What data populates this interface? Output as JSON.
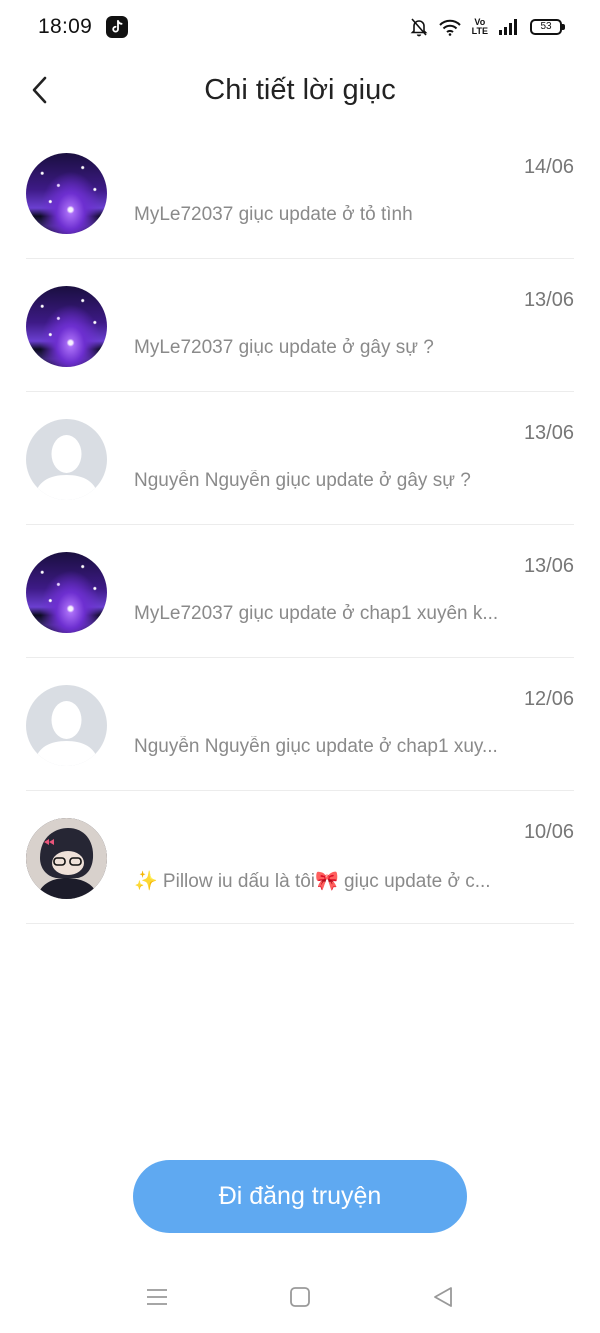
{
  "status_bar": {
    "time": "18:09",
    "battery": "53",
    "volte_top": "Vo",
    "volte_bottom": "LTE",
    "icons": [
      "tiktok-icon",
      "bell-muted-icon",
      "wifi-icon",
      "volte-icon",
      "signal-icon",
      "battery-icon"
    ]
  },
  "header": {
    "title": "Chi tiết lời giục",
    "back_icon": "chevron-left-icon"
  },
  "reminders": [
    {
      "avatar": "galaxy",
      "date": "14/06",
      "text": "MyLe72037 giục update ở tỏ tình"
    },
    {
      "avatar": "galaxy",
      "date": "13/06",
      "text": "MyLe72037 giục update ở gây sự ?"
    },
    {
      "avatar": "default",
      "date": "13/06",
      "text": "Nguyễn Nguyễn giục update ở gây sự ?"
    },
    {
      "avatar": "galaxy",
      "date": "13/06",
      "text": "MyLe72037 giục update ở chap1 xuyên k..."
    },
    {
      "avatar": "default",
      "date": "12/06",
      "text": "Nguyễn Nguyễn giục update ở chap1 xuy..."
    },
    {
      "avatar": "photo",
      "date": "10/06",
      "text": "✨ Pillow iu dấu là tôi🎀 giục update ở c..."
    }
  ],
  "cta_label": "Đi đăng truyện",
  "nav_icons": [
    "menu-icon",
    "home-square-icon",
    "back-triangle-icon"
  ],
  "colors": {
    "accent": "#5fa9f1",
    "muted_text": "#8a8a8a",
    "divider": "#ececec"
  }
}
